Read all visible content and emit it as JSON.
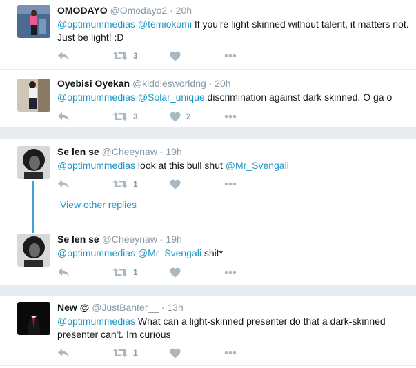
{
  "tweets": [
    {
      "name": "OMODAYO",
      "handle": "@Omodayo2",
      "time": "20h",
      "mentions": [
        "@optimummedias",
        "@temiokomi"
      ],
      "text": "If you're light-skinned without talent, it matters not. Just be light! :D",
      "retweets": "3",
      "likes": ""
    },
    {
      "name": "Oyebisi Oyekan",
      "handle": "@kiddiesworldng",
      "time": "20h",
      "mentions": [
        "@optimummedias",
        "@Solar_unique"
      ],
      "text": "discrimination against dark skinned. O ga o",
      "retweets": "3",
      "likes": "2"
    },
    {
      "name": "Se len se",
      "handle": "@Cheeynaw",
      "time": "19h",
      "mentions": [
        "@optimummedias"
      ],
      "text": "look at this bull shut",
      "mention_after": "@Mr_Svengali",
      "retweets": "1",
      "likes": ""
    },
    {
      "name": "Se len se",
      "handle": "@Cheeynaw",
      "time": "19h",
      "mentions": [
        "@optimummedias",
        "@Mr_Svengali"
      ],
      "text": "shit*",
      "retweets": "1",
      "likes": ""
    },
    {
      "name": "New @",
      "handle": "@JustBanter__",
      "time": "13h",
      "mentions": [
        "@optimummedias"
      ],
      "text": "What can a light-skinned presenter do that a dark-skinned presenter can't. Im curious",
      "retweets": "1",
      "likes": ""
    }
  ],
  "view_other_replies": "View other replies",
  "separator": "·",
  "colors": {
    "link": "#1b95c6",
    "muted": "#8899a6",
    "divider": "#e6ecf0",
    "thread": "#3fa2d6"
  },
  "icons": [
    "reply-icon",
    "retweet-icon",
    "like-icon",
    "more-icon"
  ]
}
